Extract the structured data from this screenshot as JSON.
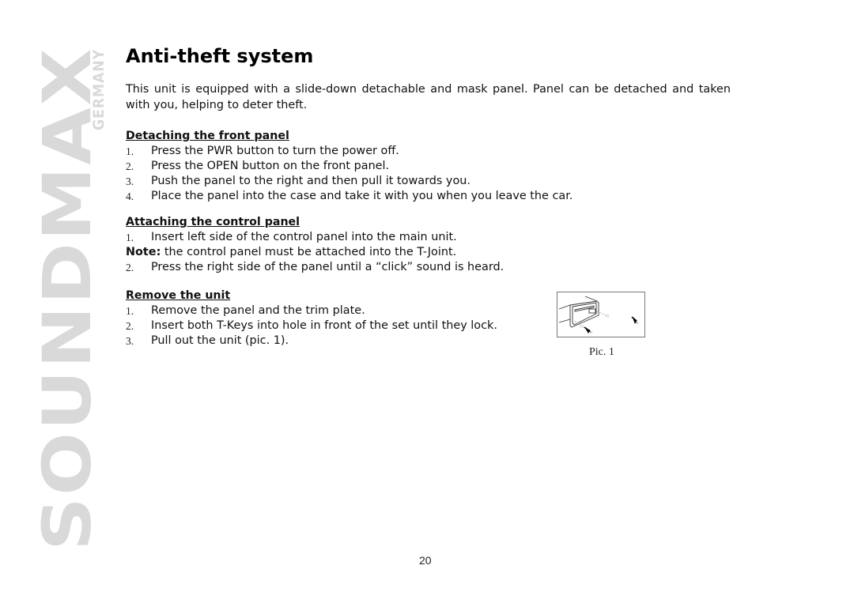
{
  "brand": {
    "name": "SOUNDMAX",
    "country": "GERMANY",
    "color": "#d9d9d9"
  },
  "page": {
    "title": "Anti-theft system",
    "intro": "This unit is equipped with a slide-down detachable and mask panel. Panel can be detached and taken with you, helping to deter theft.",
    "page_number": "20"
  },
  "sections": [
    {
      "title": "Detaching the front panel",
      "steps": [
        {
          "num": "1.",
          "text": "Press the PWR button to turn the power off."
        },
        {
          "num": "2.",
          "text": "Press the OPEN button on the front panel."
        },
        {
          "num": "3.",
          "text": "Push the panel to the right and then pull it towards you."
        },
        {
          "num": "4.",
          "text": "Place the panel into the case and take it with you when you leave the car."
        }
      ]
    },
    {
      "title": "Attaching the control panel",
      "steps": [
        {
          "num": "1.",
          "text": "Insert left side of the control panel into the main unit."
        }
      ],
      "note_label": "Note:",
      "note_text": " the control panel must be attached into the T-Joint.",
      "steps_after": [
        {
          "num": "2.",
          "text": "Press the right side of the panel until a “click” sound is heard."
        }
      ]
    },
    {
      "title": "Remove the unit",
      "steps": [
        {
          "num": "1.",
          "text": "Remove the panel and the trim plate."
        },
        {
          "num": "2.",
          "text": "Insert both T-Keys into hole in front of the set until they lock."
        },
        {
          "num": "3.",
          "text": "Pull out the unit (pic. 1)."
        }
      ]
    }
  ],
  "figure": {
    "caption": "Pic. 1",
    "description": "unit-removal-illustration"
  }
}
